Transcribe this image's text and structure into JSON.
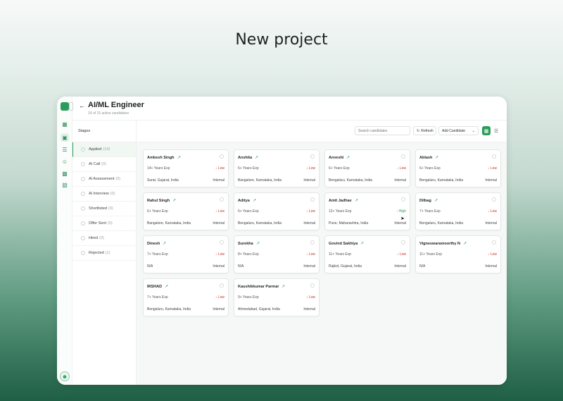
{
  "hero": {
    "title": "New project"
  },
  "header": {
    "title": "AI/ML Engineer",
    "subtitle": "14 of 15 active candidates",
    "back_icon": "arrow-left-icon"
  },
  "rail": {
    "icons": [
      "dashboard-icon",
      "briefcase-icon",
      "database-icon",
      "users-icon",
      "building-icon",
      "truck-icon"
    ],
    "avatar_icon": "user-icon"
  },
  "stages": {
    "heading": "Stages",
    "items": [
      {
        "label": "Applied",
        "count": "(14)"
      },
      {
        "label": "AI Call",
        "count": "(0)"
      },
      {
        "label": "AI Assessment",
        "count": "(0)"
      },
      {
        "label": "AI Interview",
        "count": "(0)"
      },
      {
        "label": "Shortlisted",
        "count": "(0)"
      },
      {
        "label": "Offer Sent",
        "count": "(0)"
      },
      {
        "label": "Hired",
        "count": "(0)"
      },
      {
        "label": "Rejected",
        "count": "(1)"
      }
    ]
  },
  "toolbar": {
    "search_placeholder": "Search candidates",
    "refresh_label": "Refresh",
    "add_label": "Add Candidate"
  },
  "colors": {
    "accent": "#2a9d5c",
    "low": "#c0392b",
    "high": "#2a9d5c"
  },
  "cards": [
    {
      "name": "Ambesh Singh",
      "exp": "14+ Years Exp",
      "priority": "Low",
      "location": "Surat, Gujarat, India",
      "source": "Internal"
    },
    {
      "name": "Anshita",
      "exp": "6+ Years Exp",
      "priority": "Low",
      "location": "Bangalore, Karnataka, India",
      "source": "Internal"
    },
    {
      "name": "Anveshi",
      "exp": "6+ Years Exp",
      "priority": "Low",
      "location": "Bengaluru, Karnataka, India",
      "source": "Internal"
    },
    {
      "name": "Ablash",
      "exp": "6+ Years Exp",
      "priority": "Low",
      "location": "Bengaluru, Karnataka, India",
      "source": "Internal"
    },
    {
      "name": "Rahul Singh",
      "exp": "6+ Years Exp",
      "priority": "Low",
      "location": "Bangalore, Karnataka, India",
      "source": "Internal"
    },
    {
      "name": "Aditya",
      "exp": "6+ Years Exp",
      "priority": "Low",
      "location": "Bengaluru, Karnataka, India",
      "source": "Internal"
    },
    {
      "name": "Amit Jadhav",
      "exp": "12+ Years Exp",
      "priority": "High",
      "location": "Pune, Maharashtra, India",
      "source": "Internal"
    },
    {
      "name": "Dilbag",
      "exp": "7+ Years Exp",
      "priority": "Low",
      "location": "Bengaluru, Karnataka, India",
      "source": "Internal"
    },
    {
      "name": "Dinesh",
      "exp": "7+ Years Exp",
      "priority": "Low",
      "location": "N/A",
      "source": "Internal"
    },
    {
      "name": "Surekha",
      "exp": "8+ Years Exp",
      "priority": "Low",
      "location": "N/A",
      "source": "Internal"
    },
    {
      "name": "Govind Sakhiya",
      "exp": "11+ Years Exp",
      "priority": "Low",
      "location": "Rajkot, Gujarat, India",
      "source": "Internal"
    },
    {
      "name": "Vigneswaramoorthy N",
      "exp": "11+ Years Exp",
      "priority": "Low",
      "location": "N/A",
      "source": "Internal"
    },
    {
      "name": "IRSHAD",
      "exp": "7+ Years Exp",
      "priority": "Low",
      "location": "Bengaluru, Karnataka, India",
      "source": "Internal"
    },
    {
      "name": "Kaushikkumar Parmar",
      "exp": "9+ Years Exp",
      "priority": "Low",
      "location": "Ahmedabad, Gujarat, India",
      "source": "Internal"
    }
  ]
}
